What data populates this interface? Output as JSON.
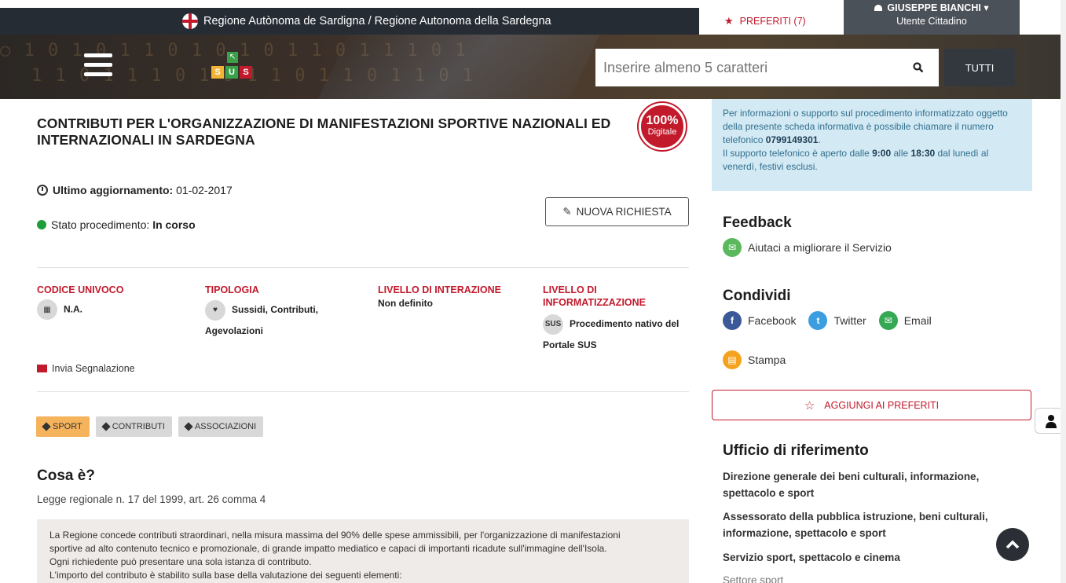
{
  "header": {
    "region_title": "Regione Autònoma de Sardigna / Regione Autonoma della Sardegna",
    "favorites_label": "PREFERITI (7)",
    "user_name": "GIUSEPPE BIANCHI",
    "user_role": "Utente Cittadino"
  },
  "banner": {
    "logo_letters": [
      "S",
      "U",
      "S"
    ],
    "search_placeholder": "Inserire almeno 5 caratteri",
    "tutti_label": "TUTTI"
  },
  "procedure": {
    "title": "CONTRIBUTI PER L'ORGANIZZAZIONE DI MANIFESTAZIONI SPORTIVE NAZIONALI ED INTERNAZIONALI IN SARDEGNA",
    "badge_pct": "100%",
    "badge_text": "Digitale",
    "updated_label": "Ultimo aggiornamento:",
    "updated_value": "01-02-2017",
    "status_label": "Stato procedimento:",
    "status_value": "In corso",
    "new_request_label": "NUOVA RICHIESTA",
    "meta": [
      {
        "heading": "CODICE UNIVOCO",
        "value": "N.A."
      },
      {
        "heading": "TIPOLOGIA",
        "value": "Sussidi, Contributi, Agevolazioni"
      },
      {
        "heading": "LIVELLO DI INTERAZIONE",
        "value": "Non definito"
      },
      {
        "heading": "LIVELLO DI INFORMATIZZAZIONE",
        "badge": "SUS",
        "value": "Procedimento nativo del Portale SUS"
      }
    ],
    "report_label": "Invia Segnalazione",
    "tags": [
      "SPORT",
      "CONTRIBUTI",
      "ASSOCIAZIONI"
    ],
    "section_title": "Cosa è?",
    "law_ref": "Legge regionale n. 17 del 1999, art. 26 comma 4",
    "description": [
      "La Regione concede contributi straordinari, nella misura massima del 90% delle spese ammissibili, per l'organizzazione di manifestazioni",
      "sportive ad alto contenuto tecnico e promozionale, di grande impatto mediatico e capaci di importanti ricadute sull'immagine dell'Isola.",
      "Ogni richiedente può presentare una sola istanza di contributo.",
      "L'importo del contributo è stabilito sulla base della valutazione dei seguenti elementi:"
    ]
  },
  "sidebar": {
    "info_text_1": "Per informazioni o supporto sul procedimento informatizzato oggetto della presente scheda informativa è possibile chiamare il numero telefonico ",
    "phone": "0799149301",
    "info_text_2": "Il supporto telefonico è aperto dalle ",
    "time_from": "9:00",
    "info_text_3": " alle ",
    "time_to": "18:30",
    "info_text_4": " dal lunedì al venerdì, festivi esclusi.",
    "feedback_title": "Feedback",
    "feedback_link": "Aiutaci a migliorare il Servizio",
    "share_title": "Condividi",
    "share": [
      "Facebook",
      "Twitter",
      "Email"
    ],
    "print_label": "Stampa",
    "add_favorites": "AGGIUNGI AI PREFERITI",
    "office_title": "Ufficio di riferimento",
    "offices": [
      "Direzione generale dei beni culturali, informazione, spettacolo e sport",
      "Assessorato della pubblica istruzione, beni culturali, informazione, spettacolo e sport",
      "Servizio sport, spettacolo e cinema"
    ],
    "office_sector": "Settore sport"
  },
  "colors": {
    "accent_red": "#c2192b",
    "status_green": "#1d9e3a",
    "tag_active": "#f5b35c",
    "info_bg": "#d3e9f3"
  }
}
